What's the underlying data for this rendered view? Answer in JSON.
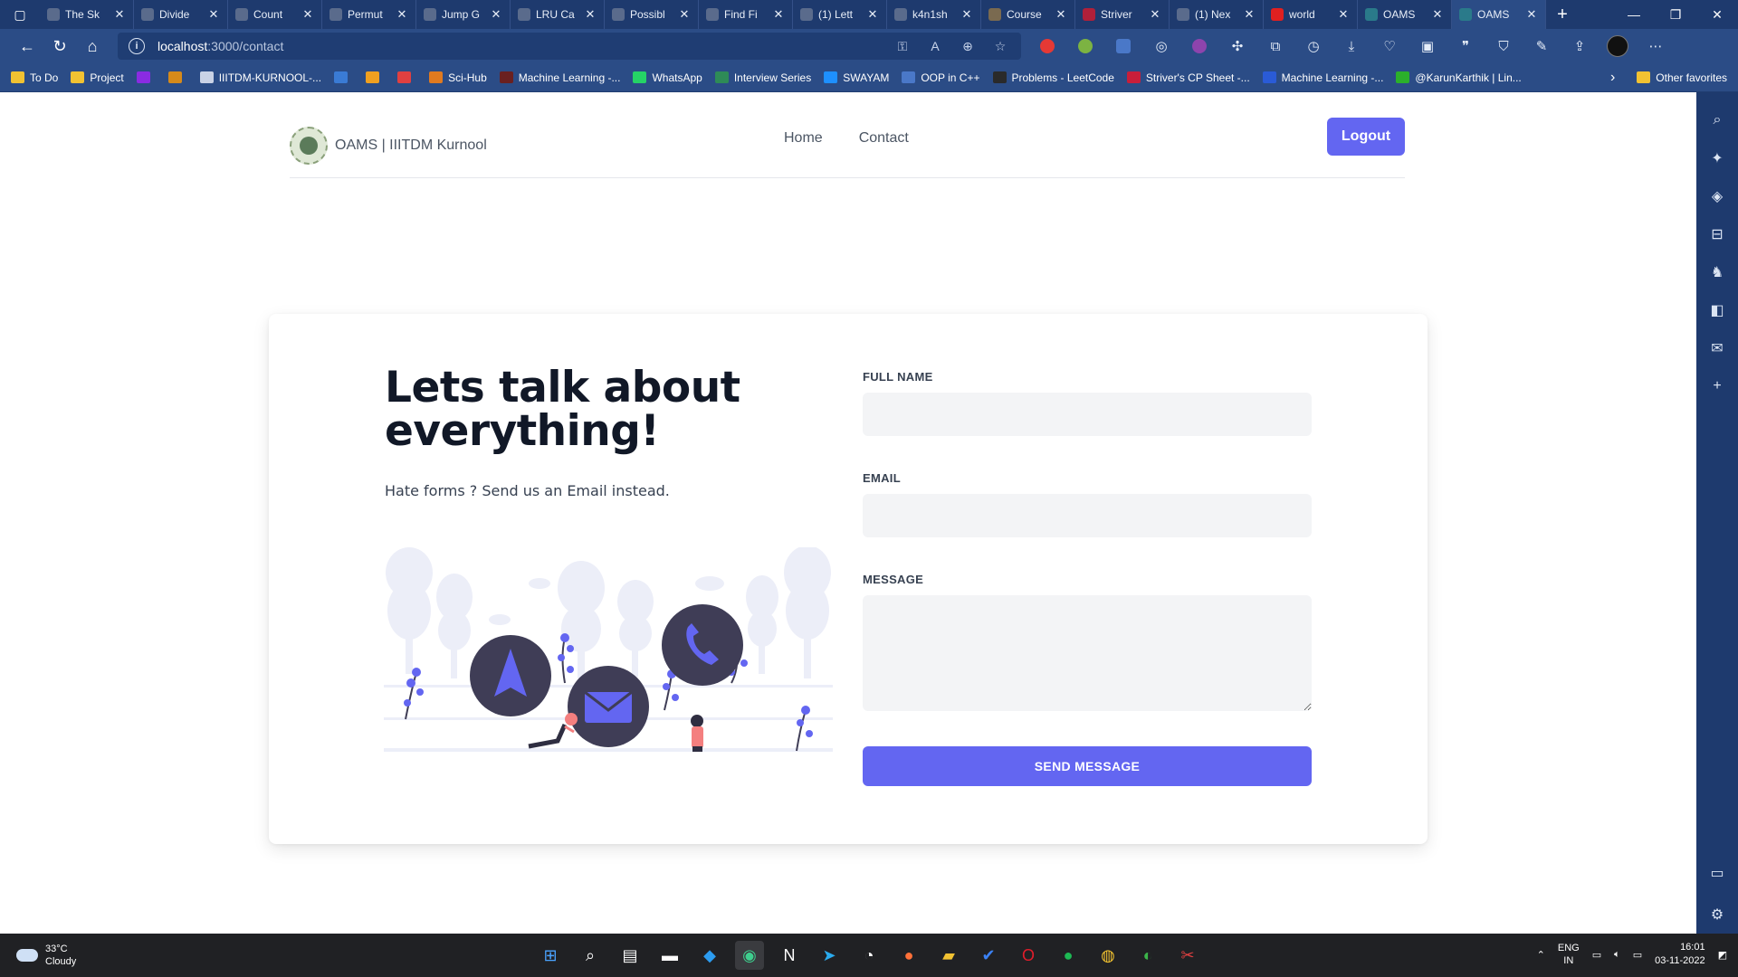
{
  "browser": {
    "tabs": [
      {
        "title": "The Sk",
        "color": "#5a6b8c"
      },
      {
        "title": "Divide",
        "color": "#5a6b8c"
      },
      {
        "title": "Count",
        "color": "#5a6b8c"
      },
      {
        "title": "Permut",
        "color": "#5a6b8c"
      },
      {
        "title": "Jump G",
        "color": "#5a6b8c"
      },
      {
        "title": "LRU Ca",
        "color": "#5a6b8c"
      },
      {
        "title": "Possibl",
        "color": "#5a6b8c"
      },
      {
        "title": "Find Fi",
        "color": "#5a6b8c"
      },
      {
        "title": "(1) Lett",
        "color": "#5a6b8c"
      },
      {
        "title": "k4n1sh",
        "color": "#5a6b8c"
      },
      {
        "title": "Course",
        "color": "#7a6a50"
      },
      {
        "title": "Striver",
        "color": "#b0203a"
      },
      {
        "title": "(1) Nex",
        "color": "#5a6b8c"
      },
      {
        "title": "world",
        "color": "#e02020"
      },
      {
        "title": "OAMS",
        "color": "#2a7a8a"
      },
      {
        "title": "OAMS",
        "color": "#2a7a8a"
      }
    ],
    "url_host": "localhost",
    "url_path": ":3000/contact",
    "bookmarks": [
      {
        "label": "To Do",
        "color": "#f1c232"
      },
      {
        "label": "Project",
        "color": "#f1c232"
      },
      {
        "label": "",
        "color": "#8a2be2"
      },
      {
        "label": "",
        "color": "#d68a1a"
      },
      {
        "label": "IIITDM-KURNOOL-...",
        "color": "#c9d2e6"
      },
      {
        "label": "",
        "color": "#3a7bd5"
      },
      {
        "label": "",
        "color": "#f0a020"
      },
      {
        "label": "",
        "color": "#e04040"
      },
      {
        "label": "Sci-Hub",
        "color": "#e07a20"
      },
      {
        "label": "Machine Learning -...",
        "color": "#6a2020"
      },
      {
        "label": "WhatsApp",
        "color": "#25d366"
      },
      {
        "label": "Interview Series",
        "color": "#2e8b57"
      },
      {
        "label": "SWAYAM",
        "color": "#1e90ff"
      },
      {
        "label": "OOP in C++",
        "color": "#4a78c8"
      },
      {
        "label": "Problems - LeetCode",
        "color": "#2a2a2a"
      },
      {
        "label": "Striver's CP Sheet -...",
        "color": "#c81e3a"
      },
      {
        "label": "Machine Learning -...",
        "color": "#2a5bd7"
      },
      {
        "label": "@KarunKarthik | Lin...",
        "color": "#2bb02b"
      }
    ],
    "other_favorites": "Other favorites"
  },
  "app": {
    "brand": "OAMS | IIITDM Kurnool",
    "nav": [
      "Home",
      "Contact"
    ],
    "logout_label": "Logout"
  },
  "contact": {
    "headline": "Lets talk about everything!",
    "subtext": "Hate forms ? Send us an Email instead.",
    "fields": {
      "full_name_label": "FULL NAME",
      "full_name_value": "",
      "email_label": "EMAIL",
      "email_value": "",
      "message_label": "MESSAGE",
      "message_value": ""
    },
    "submit_label": "SEND MESSAGE",
    "accent_color": "#6366f1"
  },
  "taskbar": {
    "weather_temp": "33°C",
    "weather_desc": "Cloudy",
    "lang_1": "ENG",
    "lang_2": "IN",
    "time": "16:01",
    "date": "03-11-2022"
  }
}
